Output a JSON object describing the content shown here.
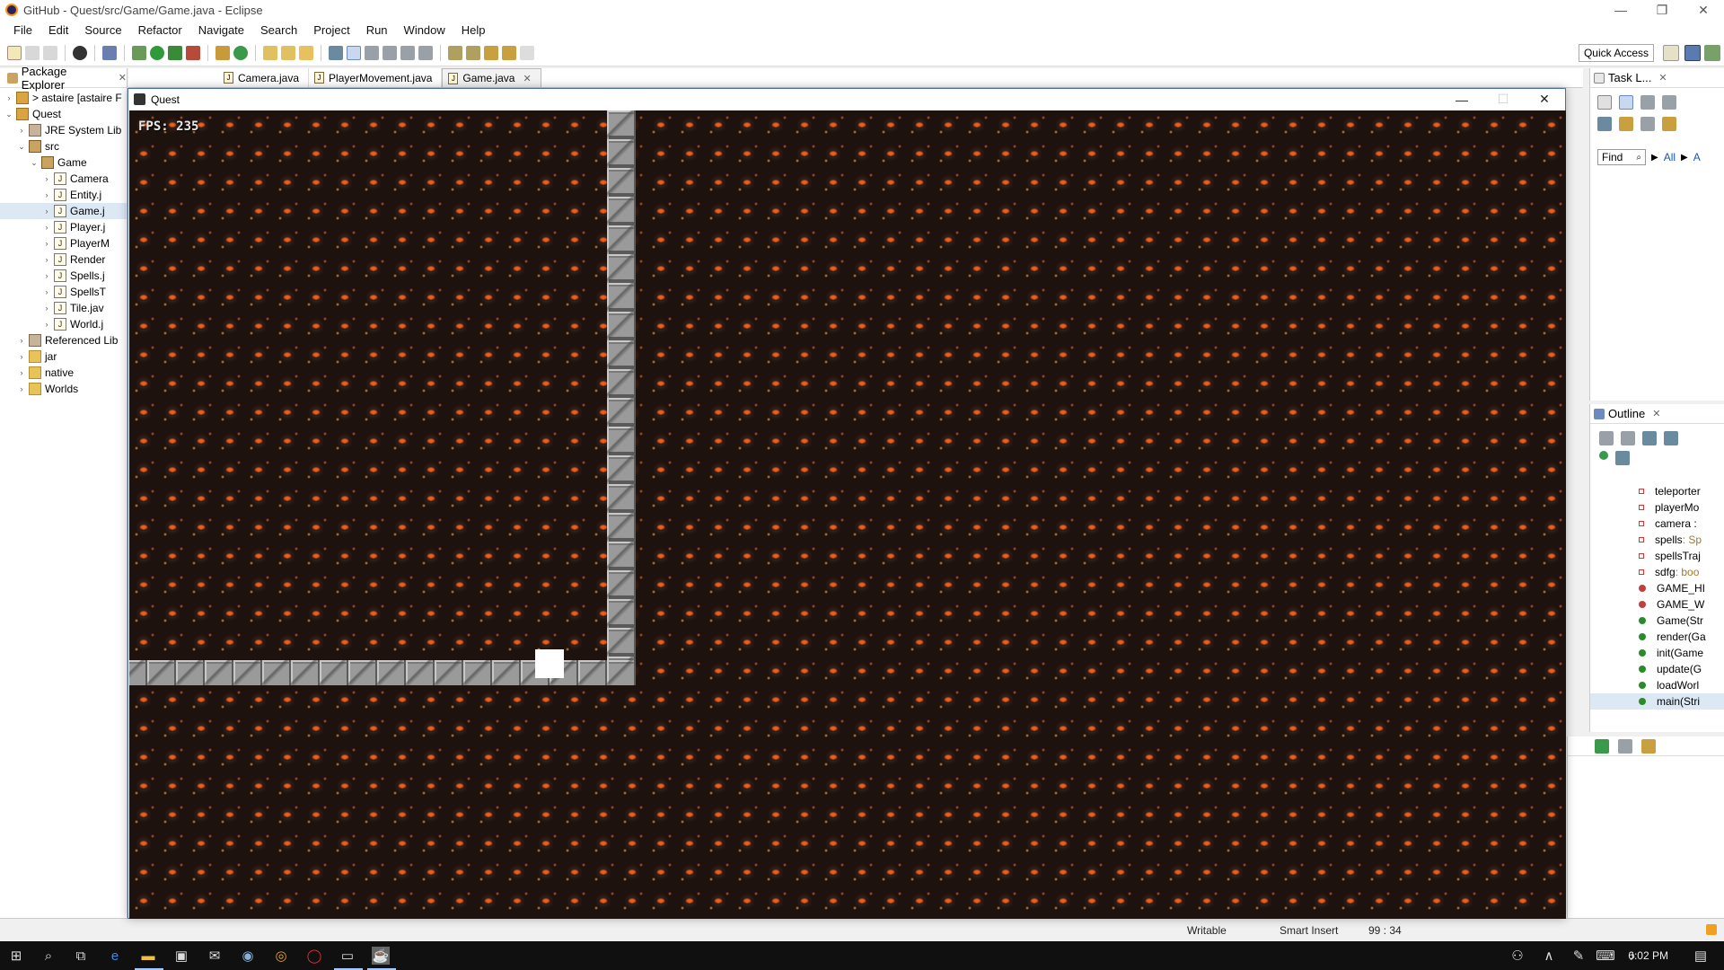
{
  "window": {
    "title": "GitHub - Quest/src/Game/Game.java - Eclipse"
  },
  "menu": [
    "File",
    "Edit",
    "Source",
    "Refactor",
    "Navigate",
    "Search",
    "Project",
    "Run",
    "Window",
    "Help"
  ],
  "toolbar": {
    "quick_access": "Quick Access"
  },
  "package_explorer": {
    "title": "Package Explorer",
    "tree": [
      {
        "label": "> astaire [astaire F",
        "indent": 0,
        "arrow": "›",
        "icon": "proj"
      },
      {
        "label": "Quest",
        "indent": 0,
        "arrow": "⌄",
        "icon": "proj"
      },
      {
        "label": "JRE System Lib",
        "indent": 1,
        "arrow": "›",
        "icon": "lib"
      },
      {
        "label": "src",
        "indent": 1,
        "arrow": "⌄",
        "icon": "pkg"
      },
      {
        "label": "Game",
        "indent": 2,
        "arrow": "⌄",
        "icon": "pkg"
      },
      {
        "label": "Camera",
        "indent": 3,
        "arrow": "›",
        "icon": "java"
      },
      {
        "label": "Entity.j",
        "indent": 3,
        "arrow": "›",
        "icon": "java"
      },
      {
        "label": "Game.j",
        "indent": 3,
        "arrow": "›",
        "icon": "java",
        "selected": true
      },
      {
        "label": "Player.j",
        "indent": 3,
        "arrow": "›",
        "icon": "java"
      },
      {
        "label": "PlayerM",
        "indent": 3,
        "arrow": "›",
        "icon": "java"
      },
      {
        "label": "Render",
        "indent": 3,
        "arrow": "›",
        "icon": "java"
      },
      {
        "label": "Spells.j",
        "indent": 3,
        "arrow": "›",
        "icon": "java"
      },
      {
        "label": "SpellsT",
        "indent": 3,
        "arrow": "›",
        "icon": "java"
      },
      {
        "label": "Tile.jav",
        "indent": 3,
        "arrow": "›",
        "icon": "java"
      },
      {
        "label": "World.j",
        "indent": 3,
        "arrow": "›",
        "icon": "java"
      },
      {
        "label": "Referenced Lib",
        "indent": 1,
        "arrow": "›",
        "icon": "lib"
      },
      {
        "label": "jar",
        "indent": 1,
        "arrow": "›",
        "icon": "folder"
      },
      {
        "label": "native",
        "indent": 1,
        "arrow": "›",
        "icon": "folder"
      },
      {
        "label": "Worlds",
        "indent": 1,
        "arrow": "›",
        "icon": "folder"
      }
    ]
  },
  "editor_tabs": [
    {
      "label": "Camera.java",
      "active": false
    },
    {
      "label": "PlayerMovement.java",
      "active": false
    },
    {
      "label": "Game.java",
      "active": true
    }
  ],
  "game_window": {
    "title": "Quest",
    "fps_text": "FPS: 235"
  },
  "task_list": {
    "title": "Task L...",
    "find_placeholder": "Find",
    "all_label": "All",
    "a_label": "A"
  },
  "outline": {
    "title": "Outline",
    "items": [
      {
        "label": "teleporter",
        "kind": "field"
      },
      {
        "label": "playerMo",
        "kind": "field"
      },
      {
        "label": "camera :",
        "kind": "field"
      },
      {
        "label": "spells",
        "suffix": " : Sp",
        "kind": "field"
      },
      {
        "label": "spellsTraj",
        "kind": "field"
      },
      {
        "label": "sdfg",
        "suffix": " : boo",
        "kind": "field"
      },
      {
        "label": "GAME_HI",
        "kind": "const"
      },
      {
        "label": "GAME_W",
        "kind": "const"
      },
      {
        "label": "Game(Str",
        "kind": "method"
      },
      {
        "label": "render(Ga",
        "kind": "method"
      },
      {
        "label": "init(Game",
        "kind": "method"
      },
      {
        "label": "update(G",
        "kind": "method"
      },
      {
        "label": "loadWorl",
        "kind": "method"
      },
      {
        "label": "main(Stri",
        "kind": "method",
        "selected": true
      }
    ]
  },
  "status": {
    "writable": "Writable",
    "insert_mode": "Smart Insert",
    "position": "99 : 34"
  },
  "taskbar": {
    "time": "6:02 PM"
  }
}
